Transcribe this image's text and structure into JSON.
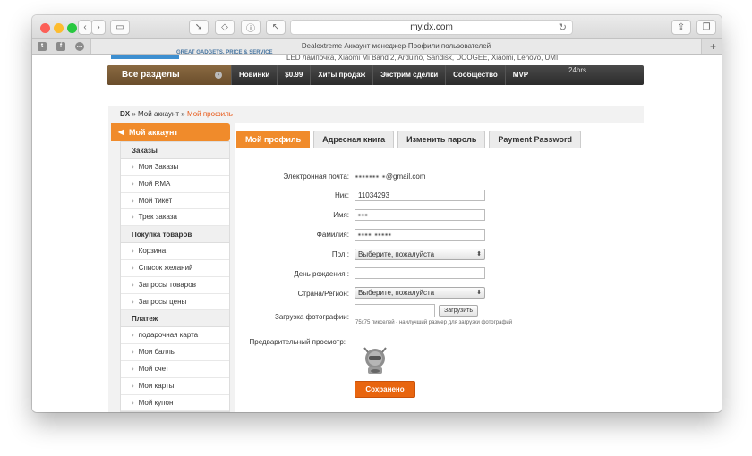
{
  "browser": {
    "url": "my.dx.com",
    "tab_title": "Dealextreme Аккаунт менеджер-Профили пользователей"
  },
  "site": {
    "tagline": "GREAT GADGETS. PRICE & SERVICE",
    "brands_line": "LED лампочка, Xiaomi Mi Band 2, Arduino, Sandisk, DOOGEE, Xiaomi, Lenovo, UMI",
    "all_sections": "Все разделы",
    "nav_items": [
      "Новинки",
      "$0.99",
      "Хиты продаж",
      "Экстрим сделки",
      "Сообщество",
      "MVP"
    ],
    "hours_badge": "24hrs"
  },
  "breadcrumb": {
    "root": "DX",
    "sep": "»",
    "account": "Мой аккаунт",
    "current": "Мой профиль"
  },
  "sidebar": {
    "title": "Мой аккаунт",
    "sections": [
      {
        "title": "Заказы",
        "items": [
          "Мои Заказы",
          "Мой RMA",
          "Мой тикет",
          "Трек заказа"
        ]
      },
      {
        "title": "Покупка товаров",
        "items": [
          "Корзина",
          "Список желаний",
          "Запросы товаров",
          "Запросы цены"
        ]
      },
      {
        "title": "Платеж",
        "items": [
          "подарочная карта",
          "Мои баллы",
          "Мой счет",
          "Мои карты",
          "Мой купон"
        ]
      }
    ]
  },
  "tabs": [
    "Мой профиль",
    "Адресная книга",
    "Изменить пароль",
    "Payment Password"
  ],
  "form": {
    "email_label": "Электронная почта:",
    "email_value": "@gmail.com",
    "nick_label": "Ник:",
    "nick_value": "11034293",
    "name_label": "Имя:",
    "surname_label": "Фамилия:",
    "gender_label": "Пол :",
    "gender_value": "Выберите, пожалуйста",
    "birthday_label": "День рождения :",
    "country_label": "Страна/Регион:",
    "country_value": "Выберите, пожалуйста",
    "photo_label": "Загрузка фотографии:",
    "upload_button": "Загрузить",
    "photo_hint": "75x75 пикселей - наилучший размер для загрузки фотографий",
    "preview_label": "Предварительный просмотр:",
    "save_button": "Сохранено"
  }
}
